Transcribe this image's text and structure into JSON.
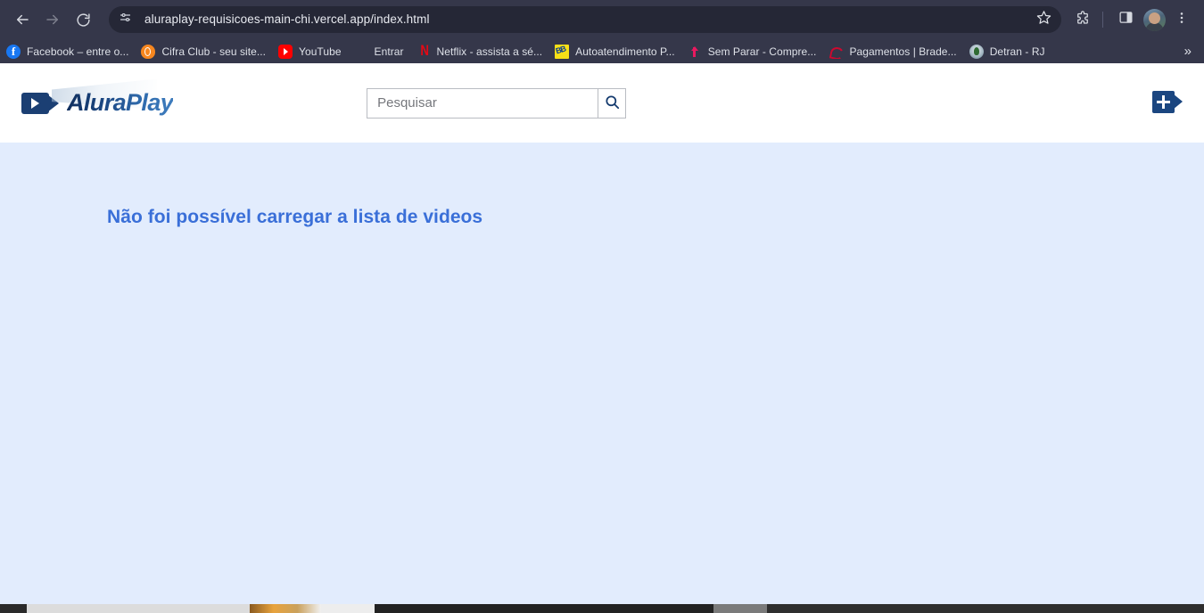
{
  "browser": {
    "back_icon": "back-arrow-icon",
    "forward_icon": "forward-arrow-icon",
    "reload_icon": "reload-icon",
    "site_info_icon": "site-settings-icon",
    "url": "aluraplay-requisicoes-main-chi.vercel.app/index.html",
    "star_icon": "bookmark-star-icon",
    "extensions_icon": "extensions-puzzle-icon",
    "side_panel_icon": "side-panel-icon",
    "profile_icon": "profile-avatar",
    "menu_icon": "three-dot-menu-icon",
    "bookmarks": [
      {
        "label": "Facebook – entre o...",
        "icon": "facebook-icon"
      },
      {
        "label": "Cifra Club - seu site...",
        "icon": "cifra-club-icon"
      },
      {
        "label": "YouTube",
        "icon": "youtube-icon"
      },
      {
        "label": "Entrar",
        "icon": "microsoft-icon"
      },
      {
        "label": "Netflix - assista a sé...",
        "icon": "netflix-icon"
      },
      {
        "label": "Autoatendimento P...",
        "icon": "banco-do-brasil-icon"
      },
      {
        "label": "Sem Parar - Compre...",
        "icon": "sem-parar-icon"
      },
      {
        "label": "Pagamentos | Brade...",
        "icon": "bradesco-icon"
      },
      {
        "label": "Detran - RJ",
        "icon": "detran-icon"
      }
    ],
    "bookmarks_overflow": "»"
  },
  "site": {
    "logo_text": "AluraPlay",
    "logo_icon": "video-camera-icon",
    "search": {
      "placeholder": "Pesquisar",
      "value": "",
      "button_icon": "search-icon"
    },
    "add_video_icon": "add-video-camera-icon",
    "main": {
      "error_message": "Não foi possível carregar a lista de videos"
    }
  },
  "colors": {
    "chrome_bg": "#35374a",
    "omnibox_bg": "#252736",
    "page_bg": "#e2ecfd",
    "header_bg": "#ffffff",
    "brand_dark_blue": "#1b3f73",
    "error_blue": "#3a6fd8"
  }
}
